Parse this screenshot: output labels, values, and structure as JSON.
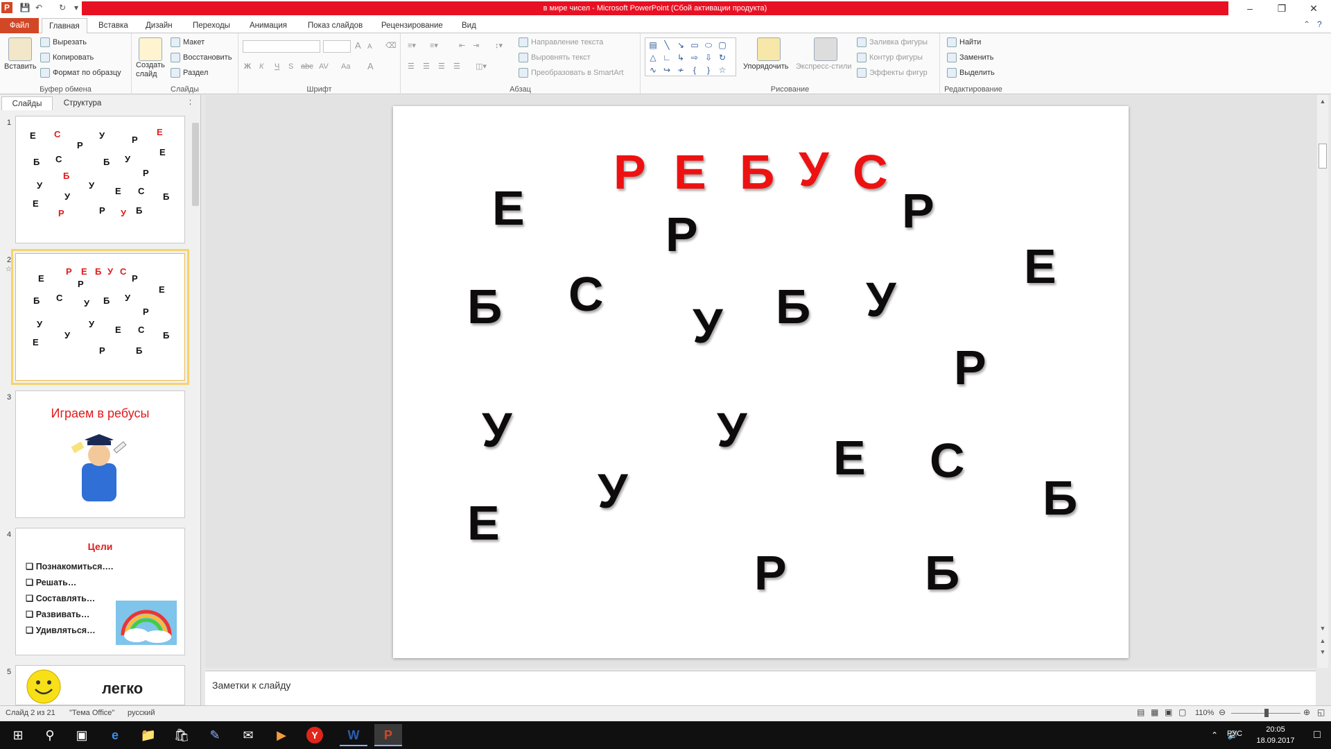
{
  "window": {
    "title": "в мире чисел  -  Microsoft PowerPoint (Сбой активации продукта)",
    "app_icon": "P"
  },
  "tabs": {
    "file": "Файл",
    "items": [
      "Главная",
      "Вставка",
      "Дизайн",
      "Переходы",
      "Анимация",
      "Показ слайдов",
      "Рецензирование",
      "Вид"
    ]
  },
  "ribbon": {
    "clipboard": {
      "paste": "Вставить",
      "cut": "Вырезать",
      "copy": "Копировать",
      "format_painter": "Формат по образцу",
      "label": "Буфер обмена"
    },
    "slides": {
      "new_slide": "Создать слайд",
      "layout": "Макет",
      "reset": "Восстановить",
      "section": "Раздел",
      "label": "Слайды"
    },
    "font": {
      "label": "Шрифт",
      "bold": "Ж",
      "italic": "К",
      "underline": "Ч",
      "strike": "abc",
      "spacing": "AV",
      "case": "Aa",
      "color": "A",
      "grow": "A",
      "shrink": "A"
    },
    "paragraph": {
      "text_direction": "Направление текста",
      "align_text": "Выровнять текст",
      "smartart": "Преобразовать в SmartArt",
      "label": "Абзац"
    },
    "drawing": {
      "arrange": "Упорядочить",
      "quick_styles": "Экспресс-стили",
      "fill": "Заливка фигуры",
      "outline": "Контур фигуры",
      "effects": "Эффекты фигур",
      "label": "Рисование"
    },
    "editing": {
      "find": "Найти",
      "replace": "Заменить",
      "select": "Выделить",
      "label": "Редактирование"
    }
  },
  "pane_tabs": {
    "slides": "Слайды",
    "outline": "Структура"
  },
  "thumbs": {
    "n1": "1",
    "n2": "2",
    "n3": "3",
    "n4": "4",
    "n5": "5",
    "t3_title": "Играем в ребусы",
    "t4_title": "Цели",
    "t4_items": [
      "Познакомиться….",
      "Решать…",
      "Составлять…",
      "Развивать…",
      "Удивляться…"
    ],
    "t5_title": "легко"
  },
  "slide": {
    "title_letters": [
      "Р",
      "Е",
      "Б",
      "У",
      "С"
    ],
    "letters": [
      "Е",
      "Р",
      "Р",
      "Е",
      "Б",
      "С",
      "У",
      "Б",
      "У",
      "Р",
      "У",
      "У",
      "Е",
      "С",
      "Б",
      "У",
      "Е",
      "Р",
      "Б"
    ]
  },
  "notes": {
    "placeholder": "Заметки к слайду"
  },
  "status": {
    "slide_info": "Слайд 2 из 21",
    "theme": "\"Тема Office\"",
    "language": "русский",
    "zoom": "110%"
  },
  "taskbar": {
    "lang": "РУС",
    "time": "20:05",
    "date": "18.09.2017"
  },
  "colors": {
    "accent_red": "#e81123",
    "letter_red": "#ee1111",
    "file_tab": "#d24726"
  }
}
